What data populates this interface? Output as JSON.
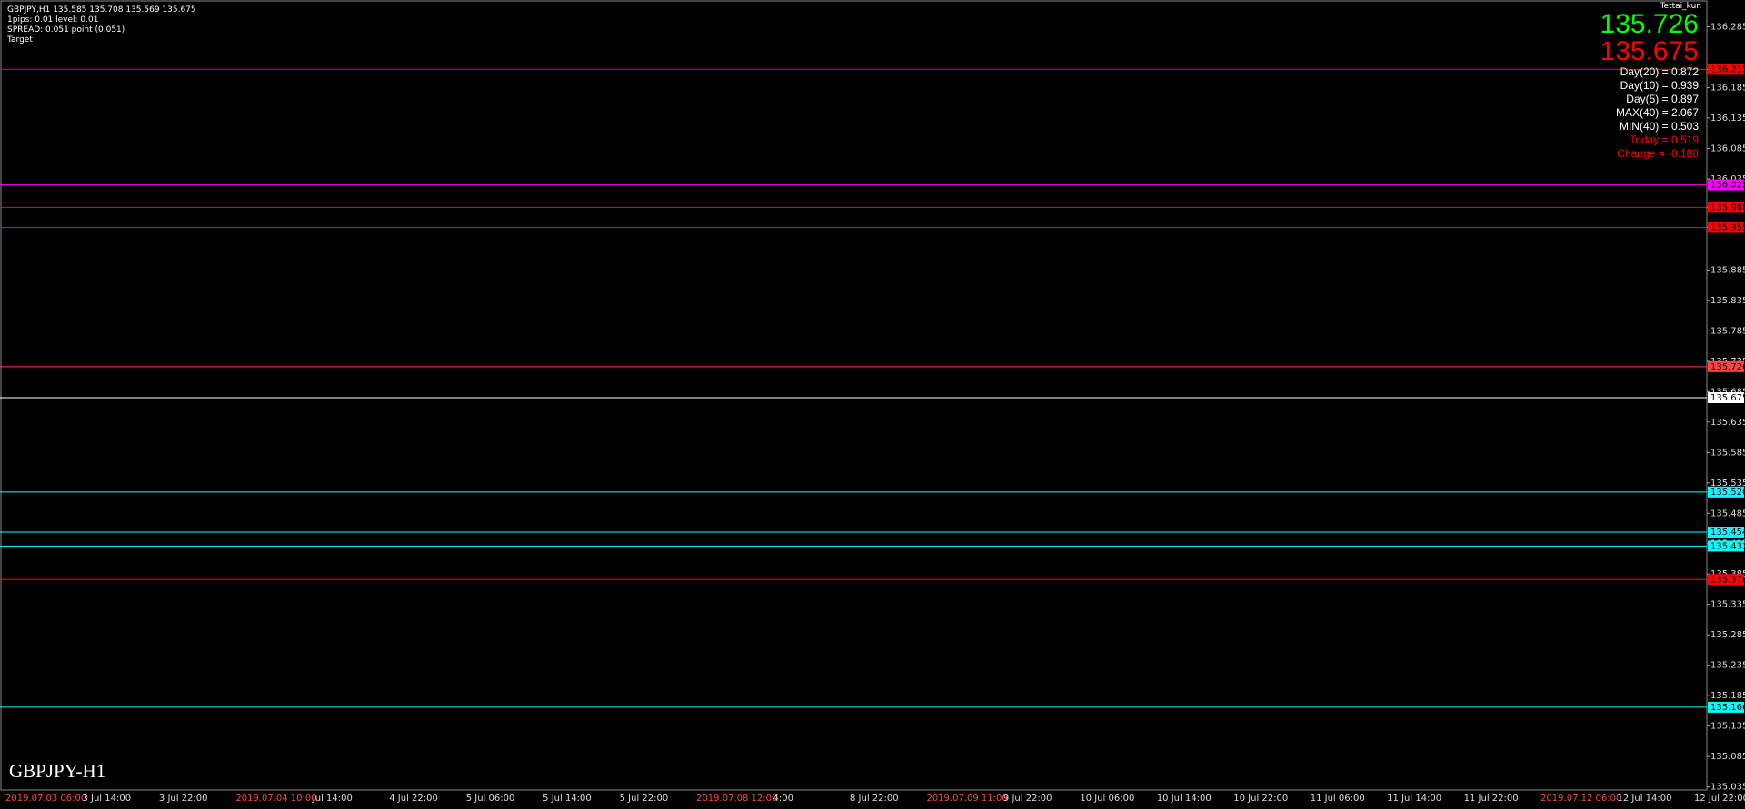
{
  "header": {
    "title": "GBPJPY,H1",
    "ohlc": "135.585 135.708 135.569 135.675",
    "pips": "1pips: 0.01 level: 0.01",
    "spread": "SPREAD: 0.051 point (0.051)",
    "target": "Target",
    "user": "Tettai_kun"
  },
  "stats": {
    "bid": "135.726",
    "ask": "135.675",
    "day20": "Day(20) = 0.872",
    "day10": "Day(10) = 0.939",
    "day5": "Day(5) = 0.897",
    "max40": "MAX(40) = 2.067",
    "min40": "MIN(40) = 0.503",
    "today": "Today = 0.519",
    "change": "Change = -0.188"
  },
  "symbol_label": "GBPJPY-H1",
  "chart_data": {
    "type": "candlestick",
    "ylim": [
      135.03,
      136.32
    ],
    "price_ticks": [
      "136.285",
      "136.215",
      "136.185",
      "136.135",
      "136.085",
      "136.035",
      "135.988",
      "135.955",
      "135.885",
      "135.835",
      "135.785",
      "135.735",
      "135.685",
      "135.635",
      "135.585",
      "135.535",
      "135.485",
      "135.435",
      "135.385",
      "135.335",
      "135.285",
      "135.235",
      "135.185",
      "135.135",
      "135.085",
      "135.035"
    ],
    "highlighted_levels": [
      {
        "value": 136.215,
        "label": "136.215",
        "color": "#ff0000"
      },
      {
        "value": 136.025,
        "label": "136.025",
        "color": "#ff00ff"
      },
      {
        "value": 135.988,
        "label": "135.988",
        "color": "#ff0000"
      },
      {
        "value": 135.955,
        "label": "135.955",
        "color": "#ff0000"
      },
      {
        "value": 135.726,
        "label": "135.726",
        "color": "#ff4444"
      },
      {
        "value": 135.675,
        "label": "135.675",
        "color": "#ffffff"
      },
      {
        "value": 135.52,
        "label": "135.520",
        "color": "#00ffff"
      },
      {
        "value": 135.454,
        "label": "135.454",
        "color": "#00ffff"
      },
      {
        "value": 135.431,
        "label": "135.431",
        "color": "#00ffff"
      },
      {
        "value": 135.376,
        "label": "135.376",
        "color": "#ff0000"
      },
      {
        "value": 135.166,
        "label": "135.166",
        "color": "#00ffff"
      }
    ],
    "time_labels": [
      "2019.07.03 06:00",
      "3 Jul 14:00",
      "3 Jul 22:00",
      "2019.07.04 10:00",
      "Jul 14:00",
      "4 Jul 22:00",
      "5 Jul 06:00",
      "5 Jul 14:00",
      "5 Jul 22:00",
      "2019.07.08 12:00",
      "4:00",
      "8 Jul 22:00",
      "2019.07.09 11:00",
      "9 Jul 22:00",
      "10 Jul 06:00",
      "10 Jul 14:00",
      "10 Jul 22:00",
      "11 Jul 06:00",
      "11 Jul 14:00",
      "11 Jul 22:00",
      "2019.07.12 06:00",
      "12 Jul 14:00",
      "12 Jul 22:00"
    ]
  }
}
